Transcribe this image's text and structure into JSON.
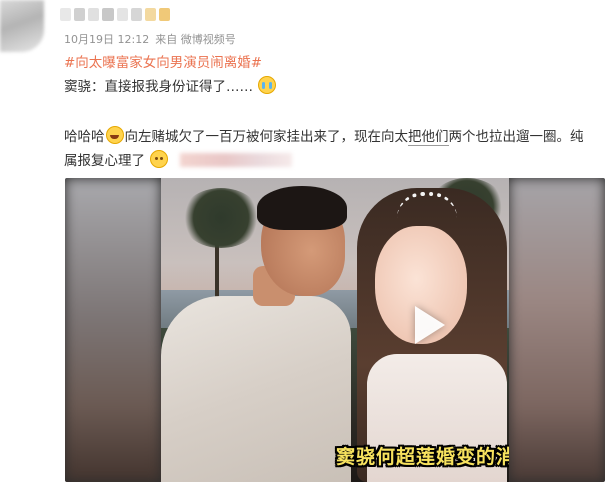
{
  "post": {
    "time": "10月19日 12:12",
    "source": "来自 微博视频号",
    "topic": "#向太曝富家女向男演员闹离婚#",
    "line1": "窦骁：直接报我身份证得了……",
    "line2_a": "哈哈哈",
    "line2_b": "向左赌城欠了一百万被何家挂出来了，现在向太",
    "line2_underlined": "把他们",
    "line2_c": "两个也拉出遛一圈。纯",
    "line3": "属报复心理了"
  },
  "video": {
    "caption": "窦骁何超莲婚变的消息"
  },
  "colors": {
    "topic": "#eb7350",
    "meta": "#939393",
    "caption": "#f7e25e"
  },
  "icons": [
    "cry-emoji-icon",
    "laugh-emoji-icon",
    "sweat-emoji-icon",
    "play-icon"
  ]
}
